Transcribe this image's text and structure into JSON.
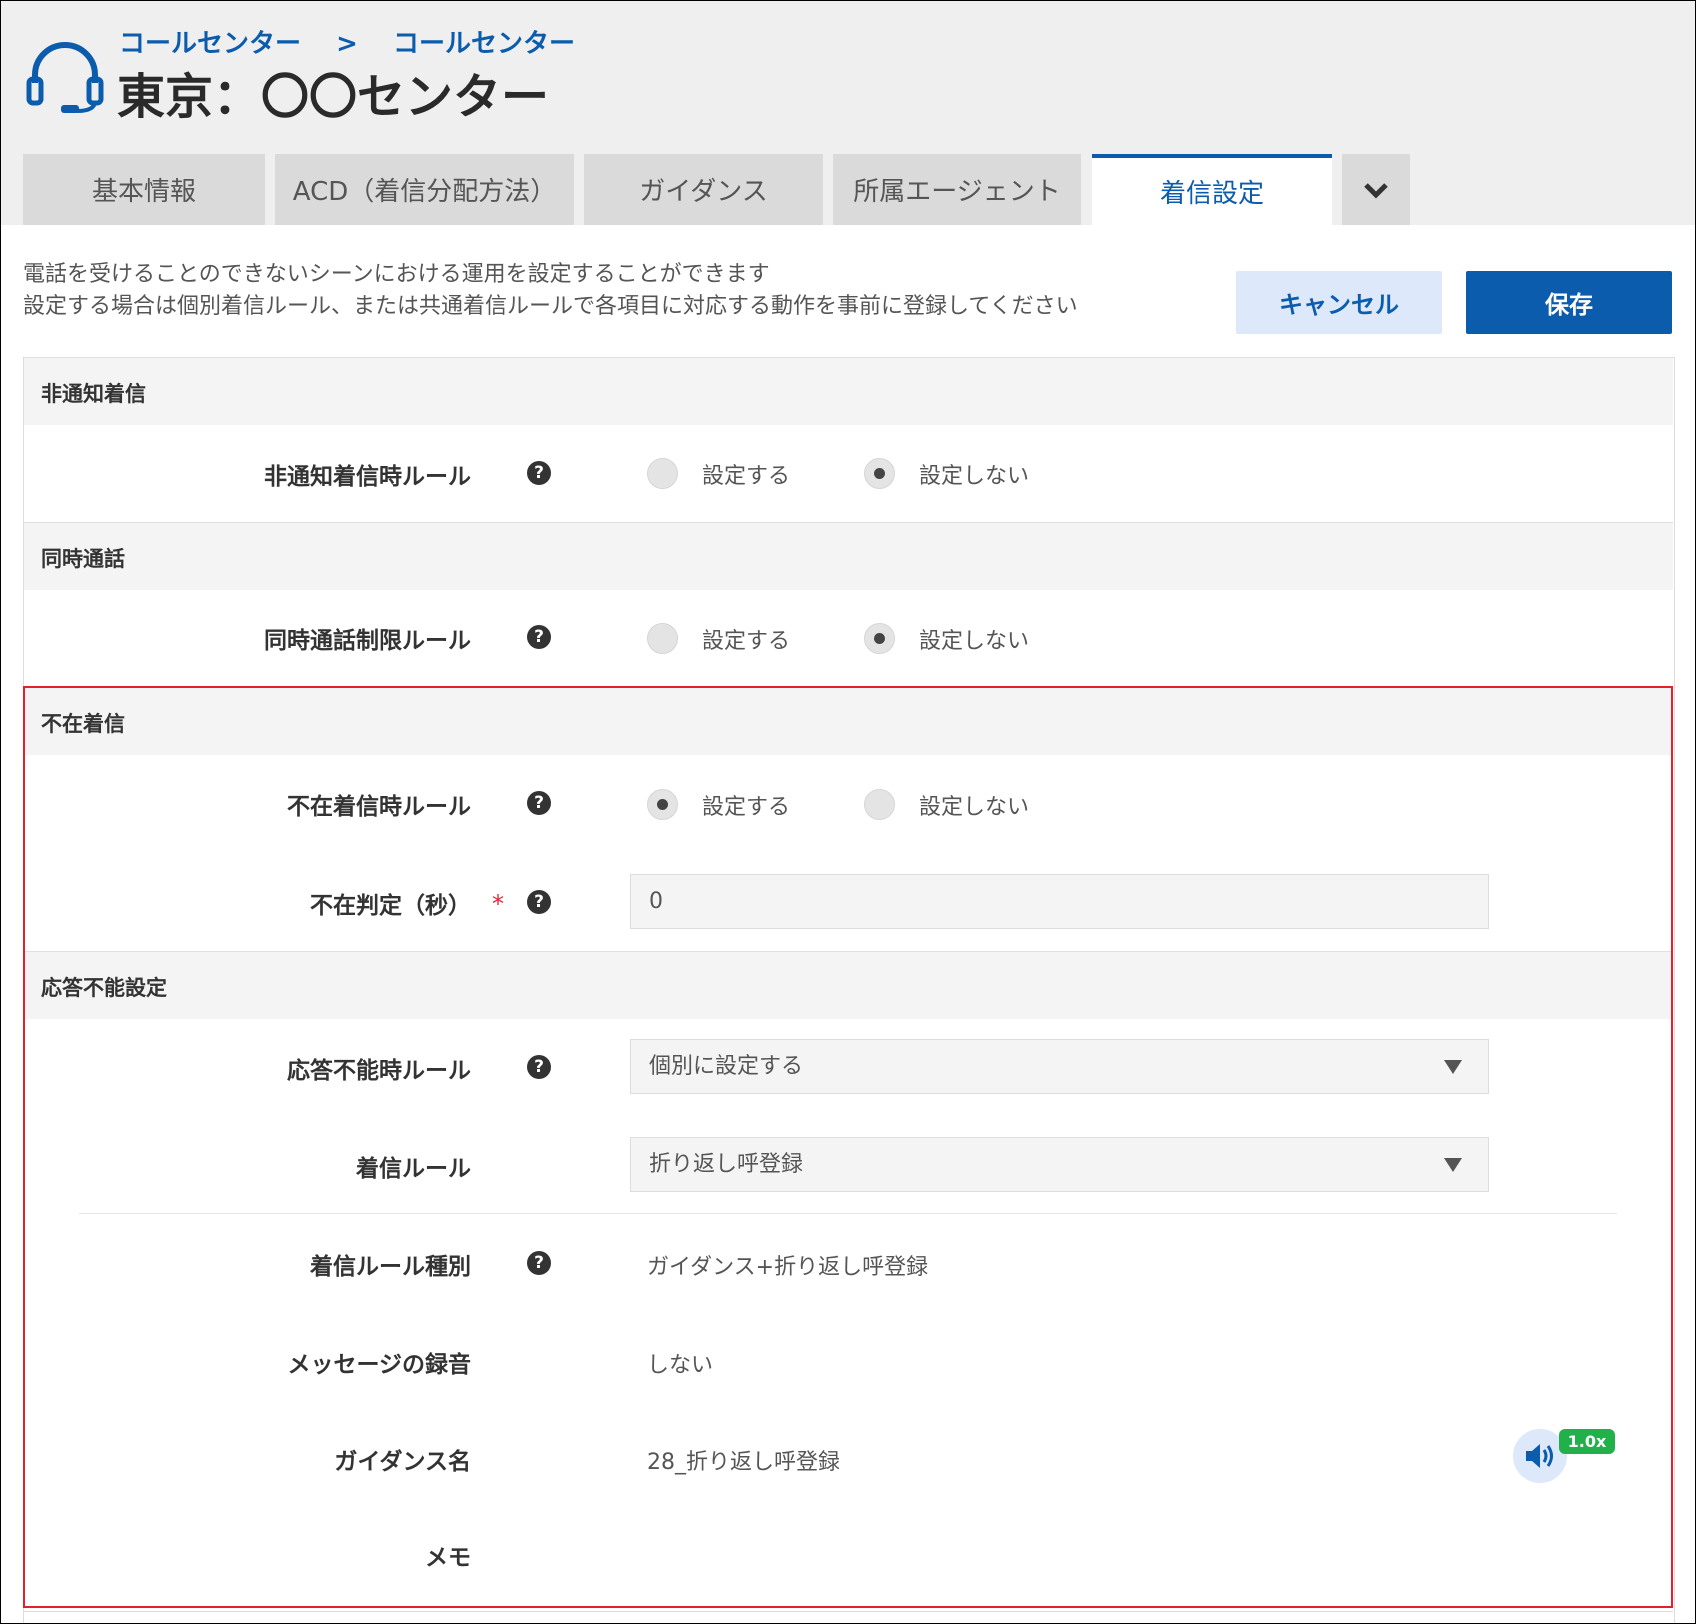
{
  "breadcrumb": {
    "parent": "コールセンター",
    "separator": ">",
    "current": "コールセンター"
  },
  "page": {
    "title": "東京：〇〇センター"
  },
  "tabs": [
    {
      "label": "基本情報"
    },
    {
      "label": "ACD（着信分配方法）"
    },
    {
      "label": "ガイダンス"
    },
    {
      "label": "所属エージェント"
    },
    {
      "label": "着信設定"
    }
  ],
  "description": {
    "line1": "電話を受けることのできないシーンにおける運用を設定することができます",
    "line2": "設定する場合は個別着信ルール、または共通着信ルールで各項目に対応する動作を事前に登録してください"
  },
  "buttons": {
    "cancel": "キャンセル",
    "save": "保存"
  },
  "sections": {
    "anonymous": {
      "title": "非通知着信",
      "rule_label": "非通知着信時ルール",
      "option_on": "設定する",
      "option_off": "設定しない",
      "selected": "設定しない"
    },
    "concurrent": {
      "title": "同時通話",
      "rule_label": "同時通話制限ルール",
      "option_on": "設定する",
      "option_off": "設定しない",
      "selected": "設定しない"
    },
    "absence": {
      "title": "不在着信",
      "rule_label": "不在着信時ルール",
      "option_on": "設定する",
      "option_off": "設定しない",
      "selected": "設定する",
      "judge_label": "不在判定（秒）",
      "required_mark": "*",
      "judge_value": "0"
    },
    "unanswerable": {
      "title": "応答不能設定",
      "rule_label": "応答不能時ルール",
      "rule_value": "個別に設定する",
      "incoming_rule_label": "着信ルール",
      "incoming_rule_value": "折り返し呼登録",
      "rule_type_label": "着信ルール種別",
      "rule_type_value": "ガイダンス+折り返し呼登録",
      "record_label": "メッセージの録音",
      "record_value": "しない",
      "guidance_label": "ガイダンス名",
      "guidance_value": "28_折り返し呼登録",
      "playback_speed": "1.0x",
      "memo_label": "メモ"
    }
  },
  "colors": {
    "accent": "#0b5cad",
    "highlight_border": "#e3202b",
    "speed_badge": "#22b04b"
  }
}
